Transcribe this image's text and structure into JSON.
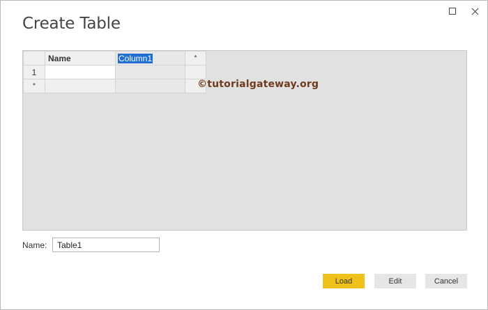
{
  "dialog": {
    "title": "Create Table",
    "controls": {
      "maximize_icon": "maximize-icon",
      "close_icon": "close-icon"
    }
  },
  "table": {
    "header_corner": "",
    "columns": [
      "Name",
      "Column1",
      "*"
    ],
    "rows": [
      {
        "header": "1",
        "cells": [
          "",
          ""
        ]
      },
      {
        "header": "*",
        "cells": [
          "",
          ""
        ]
      }
    ]
  },
  "watermark": "©tutorialgateway.org",
  "name_field": {
    "label": "Name:",
    "value": "Table1"
  },
  "buttons": {
    "load": "Load",
    "edit": "Edit",
    "cancel": "Cancel"
  },
  "colors": {
    "accent": "#eec21a",
    "selection": "#1e6fcf"
  }
}
